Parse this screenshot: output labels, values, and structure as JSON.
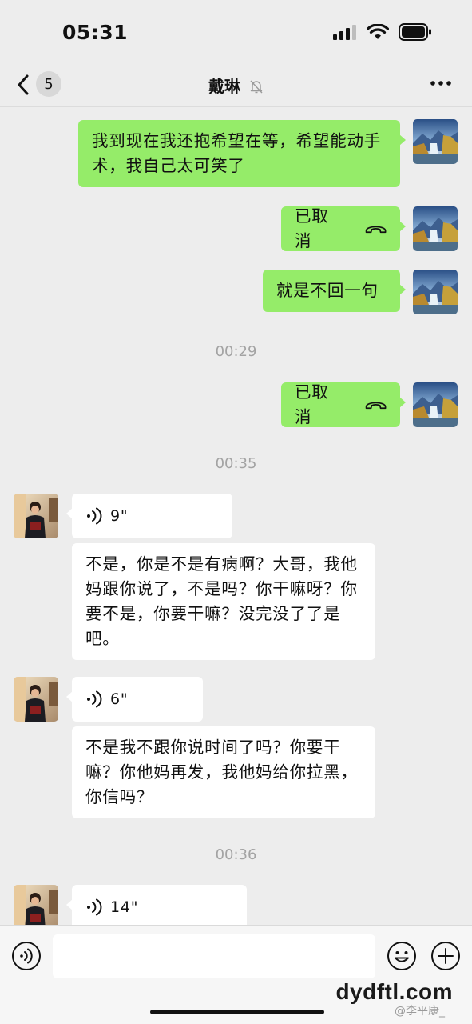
{
  "status_bar": {
    "time": "05:31"
  },
  "nav": {
    "back_count": "5",
    "title": "戴琳"
  },
  "messages": [
    {
      "side": "self",
      "type": "text",
      "text": "我到现在我还抱希望在等，希望能动手术，我自己太可笑了"
    },
    {
      "side": "self",
      "type": "call",
      "text": "已取消"
    },
    {
      "side": "self",
      "type": "text",
      "text": "就是不回一句"
    },
    {
      "type": "time",
      "text": "00:29"
    },
    {
      "side": "self",
      "type": "call",
      "text": "已取消"
    },
    {
      "type": "time",
      "text": "00:35"
    },
    {
      "side": "other",
      "type": "voice",
      "duration": "9\""
    },
    {
      "side": "other",
      "type": "text",
      "text": "不是，你是不是有病啊？大哥，我他妈跟你说了，不是吗？你干嘛呀？你要不是，你要干嘛？没完没了了是吧。"
    },
    {
      "side": "other",
      "type": "voice",
      "duration": "6\""
    },
    {
      "side": "other",
      "type": "text",
      "text": "不是我不跟你说时间了吗？你要干嘛？你他妈再发，我他妈给你拉黑，你信吗？"
    },
    {
      "type": "time",
      "text": "00:36"
    },
    {
      "side": "other",
      "type": "voice",
      "duration": "14\""
    }
  ],
  "overlay": {
    "watermark": "dydftl.com",
    "weibo": "@李平康_"
  },
  "colors": {
    "self_bubble": "#95ec69",
    "other_bubble": "#ffffff",
    "background": "#ededed"
  },
  "icons": [
    "back-chevron-icon",
    "mute-bell-icon",
    "more-icon",
    "hang-up-icon",
    "voice-wave-icon",
    "voice-input-icon",
    "emoji-icon",
    "plus-icon"
  ]
}
